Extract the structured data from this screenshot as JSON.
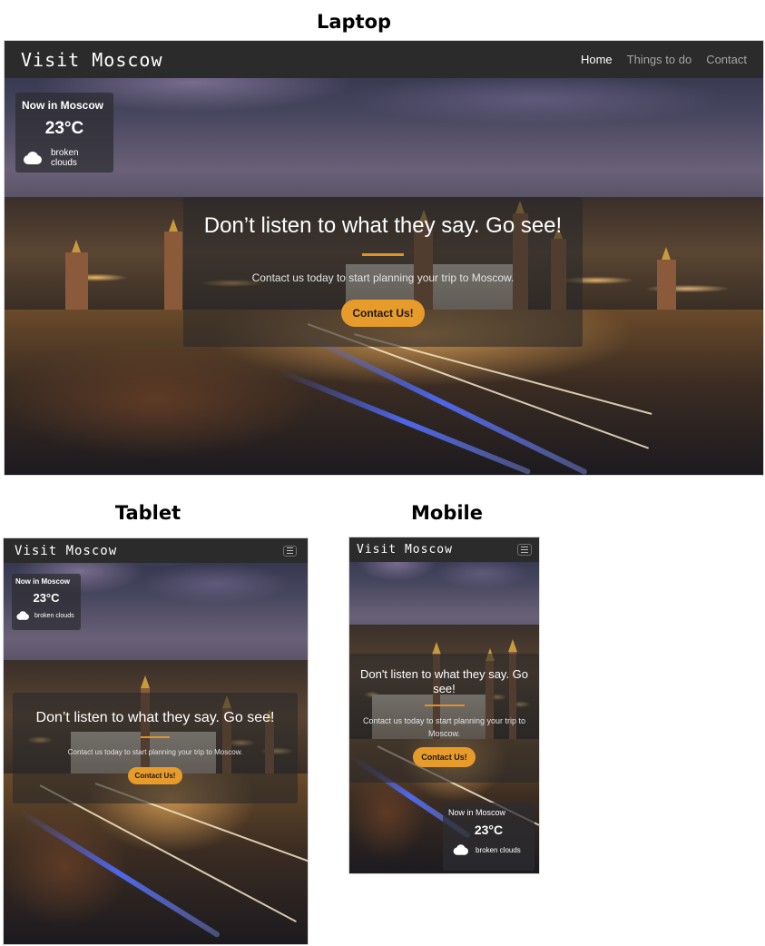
{
  "labels": {
    "laptop": "Laptop",
    "tablet": "Tablet",
    "mobile": "Mobile"
  },
  "brand": "Visit Moscow",
  "nav": {
    "home": "Home",
    "things": "Things to do",
    "contact": "Contact"
  },
  "weather": {
    "title": "Now in Moscow",
    "temp": "23°C",
    "description": "broken clouds",
    "icon": "cloud-icon"
  },
  "hero": {
    "title": "Don’t listen to what they say. Go see!",
    "title_mobile": "Don't listen to what they say. Go see!",
    "subtitle": "Contact us today to start planning your trip to Moscow.",
    "cta": "Contact Us!"
  },
  "colors": {
    "navbar": "#2b2b2b",
    "accent": "#e79b2b",
    "divider": "#e29322"
  }
}
